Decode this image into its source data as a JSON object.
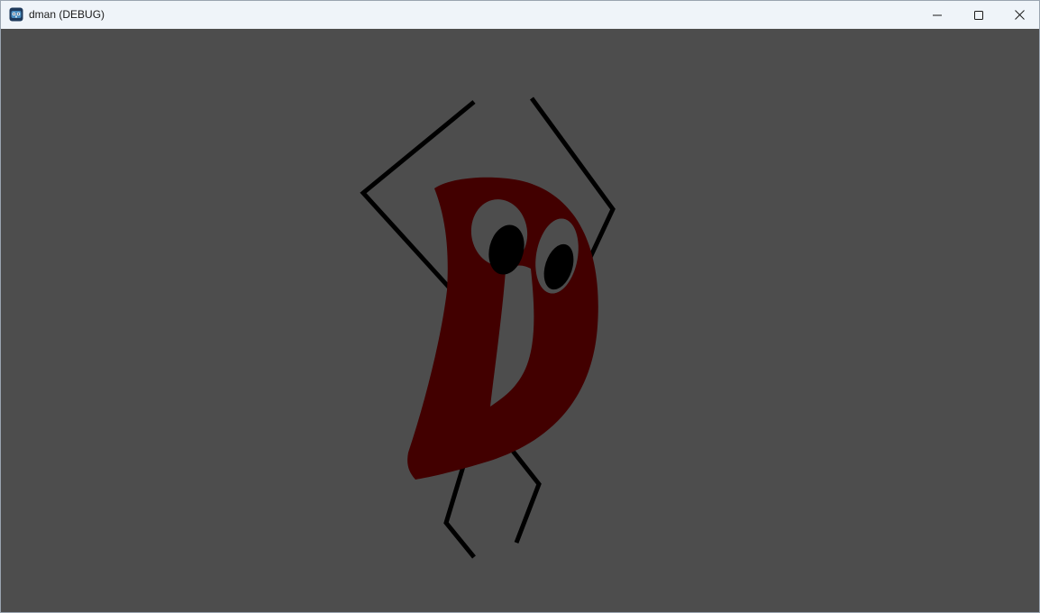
{
  "window": {
    "title": "dman (DEBUG)",
    "app_icon": "godot-engine-icon",
    "controls": {
      "minimize": "minimize-icon",
      "maximize": "maximize-icon",
      "close": "close-icon"
    }
  },
  "viewport": {
    "background_color": "#4d4d4d",
    "character": {
      "body_color": "#420000",
      "limb_color": "#000000",
      "eye_white_color": "#4d4d4d",
      "pupil_color": "#000000"
    }
  }
}
